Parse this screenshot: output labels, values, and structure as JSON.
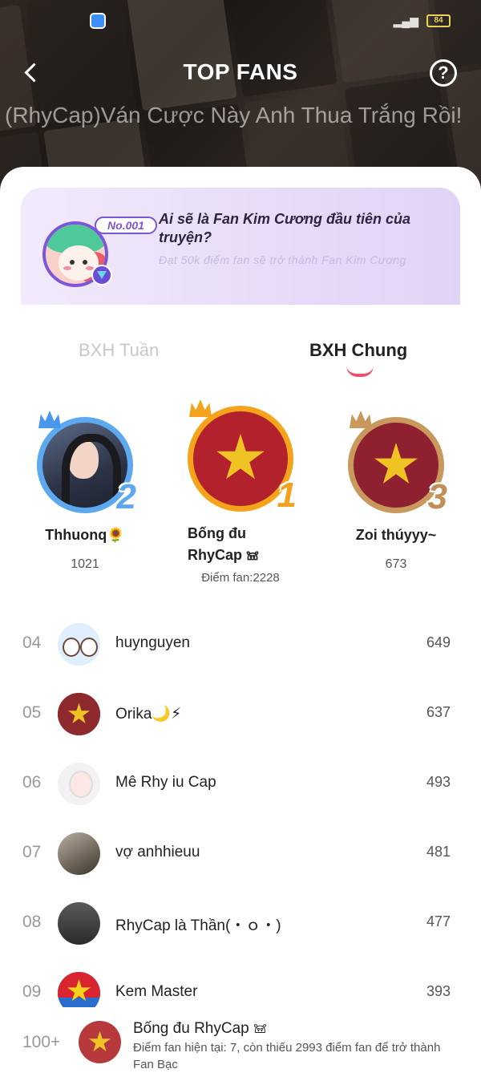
{
  "header": {
    "title": "TOP FANS",
    "story_title": "(RhyCap)Ván Cược Này Anh Thua Trắng Rồi!",
    "battery": "84",
    "back_icon": "chevron-left-icon",
    "help_icon": "question-circle-icon",
    "help_symbol": "?"
  },
  "promo": {
    "badge": "No.001",
    "title": "Ai sẽ là Fan Kim Cương đầu tiên của truyện?",
    "subtitle": "Đạt 50k điểm fan sẽ trở thành Fan Kim Cương",
    "accent_color": "#7b56d8"
  },
  "tabs": [
    {
      "label": "BXH Tuần",
      "active": false
    },
    {
      "label": "BXH Chung",
      "active": true
    }
  ],
  "podium": [
    {
      "rank": "2",
      "name": "Thhuonq🌻",
      "score": "1021",
      "tier": "silver"
    },
    {
      "rank": "1",
      "name": "Bống đu RhyCap 𖠌",
      "score_label": "Điểm fan:2228",
      "tier": "gold"
    },
    {
      "rank": "3",
      "name": "Zoi thúyyy~",
      "score": "673",
      "tier": "bronze"
    }
  ],
  "list": [
    {
      "rank": "04",
      "name": "huynguyen",
      "score": "649"
    },
    {
      "rank": "05",
      "name": "Orika🌙⚡",
      "score": "637"
    },
    {
      "rank": "06",
      "name": "Mê Rhy iu Cap",
      "score": "493"
    },
    {
      "rank": "07",
      "name": "vợ anhhieuu",
      "score": "481"
    },
    {
      "rank": "08",
      "name": "RhyCap là Thần(・ｏ・)",
      "score": "477"
    },
    {
      "rank": "09",
      "name": "Kem Master",
      "score": "393"
    }
  ],
  "me": {
    "rank": "100+",
    "name": "Bống đu RhyCap 𖠌",
    "desc": "Điểm fan hiện tại: 7, còn thiếu 2993 điểm fan để trở thành Fan Bạc"
  }
}
